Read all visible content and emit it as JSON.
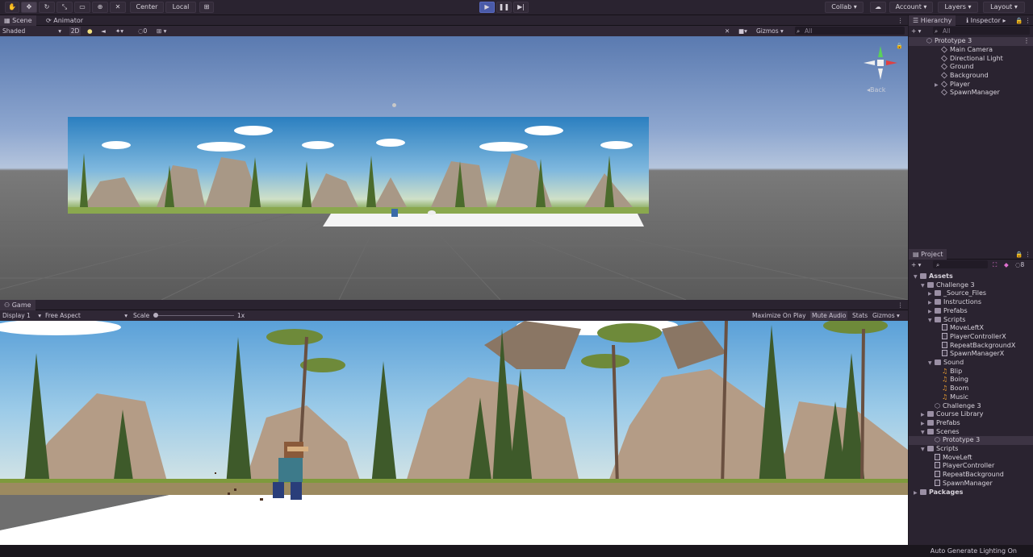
{
  "toolbar": {
    "center": "Center",
    "local": "Local",
    "collab": "Collab",
    "account": "Account",
    "layers": "Layers",
    "layout": "Layout"
  },
  "scene_panel": {
    "tabs": [
      "Scene",
      "Animator"
    ],
    "shading": "Shaded",
    "mode2d": "2D",
    "fx_count": "0",
    "gizmos": "Gizmos",
    "search_placeholder": "All",
    "back_label": "Back"
  },
  "game_panel": {
    "tab": "Game",
    "display": "Display 1",
    "aspect": "Free Aspect",
    "scale_label": "Scale",
    "scale_value": "1x",
    "maximize": "Maximize On Play",
    "mute": "Mute Audio",
    "stats": "Stats",
    "gizmos": "Gizmos"
  },
  "hierarchy": {
    "tabs": [
      "Hierarchy",
      "Inspector"
    ],
    "search_placeholder": "All",
    "scene": "Prototype 3",
    "items": [
      "Main Camera",
      "Directional Light",
      "Ground",
      "Background",
      "Player",
      "SpawnManager"
    ]
  },
  "project": {
    "tab": "Project",
    "count": "8",
    "tree": [
      {
        "label": "Assets",
        "depth": 0,
        "type": "folder",
        "bold": true
      },
      {
        "label": "Challenge 3",
        "depth": 1,
        "type": "folder"
      },
      {
        "label": "_Source_Files",
        "depth": 2,
        "type": "folder"
      },
      {
        "label": "Instructions",
        "depth": 2,
        "type": "folder"
      },
      {
        "label": "Prefabs",
        "depth": 2,
        "type": "folder"
      },
      {
        "label": "Scripts",
        "depth": 2,
        "type": "folder"
      },
      {
        "label": "MoveLeftX",
        "depth": 3,
        "type": "script"
      },
      {
        "label": "PlayerControllerX",
        "depth": 3,
        "type": "script"
      },
      {
        "label": "RepeatBackgroundX",
        "depth": 3,
        "type": "script"
      },
      {
        "label": "SpawnManagerX",
        "depth": 3,
        "type": "script"
      },
      {
        "label": "Sound",
        "depth": 2,
        "type": "folder"
      },
      {
        "label": "Blip",
        "depth": 3,
        "type": "sound"
      },
      {
        "label": "Boing",
        "depth": 3,
        "type": "sound"
      },
      {
        "label": "Boom",
        "depth": 3,
        "type": "sound"
      },
      {
        "label": "Music",
        "depth": 3,
        "type": "sound"
      },
      {
        "label": "Challenge 3",
        "depth": 2,
        "type": "scene"
      },
      {
        "label": "Course Library",
        "depth": 1,
        "type": "folder"
      },
      {
        "label": "Prefabs",
        "depth": 1,
        "type": "folder"
      },
      {
        "label": "Scenes",
        "depth": 1,
        "type": "folder"
      },
      {
        "label": "Prototype 3",
        "depth": 2,
        "type": "scene",
        "selected": true
      },
      {
        "label": "Scripts",
        "depth": 1,
        "type": "folder"
      },
      {
        "label": "MoveLeft",
        "depth": 2,
        "type": "script"
      },
      {
        "label": "PlayerController",
        "depth": 2,
        "type": "script"
      },
      {
        "label": "RepeatBackground",
        "depth": 2,
        "type": "script"
      },
      {
        "label": "SpawnManager",
        "depth": 2,
        "type": "script"
      },
      {
        "label": "Packages",
        "depth": 0,
        "type": "folder",
        "bold": true
      }
    ]
  },
  "status": {
    "text": "Auto Generate Lighting On"
  },
  "colors": {
    "play": "#4a5aa8",
    "selection": "#3d3444",
    "accent": "#e070d0"
  }
}
